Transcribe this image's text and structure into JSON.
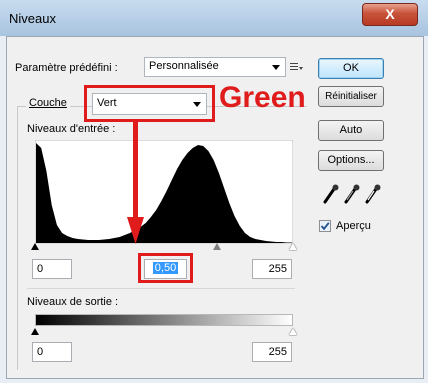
{
  "window": {
    "title": "Niveaux",
    "close_glyph": "X"
  },
  "preset": {
    "label": "Paramètre prédéfini :",
    "value": "Personnalisée",
    "menu_icon": "list-menu-icon"
  },
  "channel": {
    "label": "Couche",
    "value": "Vert"
  },
  "annotation": {
    "text": "Green",
    "color": "#e01b1b"
  },
  "input_levels": {
    "label": "Niveaux d'entrée :",
    "black": "0",
    "gamma": "0,50",
    "white": "255"
  },
  "output_levels": {
    "label": "Niveaux de sortie :",
    "black": "0",
    "white": "255"
  },
  "buttons": {
    "ok": "OK",
    "reset": "Réinitialiser",
    "auto": "Auto",
    "options": "Options..."
  },
  "preview": {
    "label": "Aperçu",
    "checked": true
  },
  "eyedroppers": [
    "black-eyedropper-icon",
    "gray-eyedropper-icon",
    "white-eyedropper-icon"
  ],
  "histogram": {
    "bins": [
      1.0,
      0.95,
      0.72,
      0.38,
      0.18,
      0.1,
      0.07,
      0.05,
      0.04,
      0.035,
      0.03,
      0.03,
      0.03,
      0.035,
      0.04,
      0.05,
      0.06,
      0.08,
      0.1,
      0.13,
      0.16,
      0.2,
      0.26,
      0.33,
      0.42,
      0.52,
      0.63,
      0.74,
      0.83,
      0.9,
      0.95,
      0.98,
      0.97,
      0.92,
      0.83,
      0.7,
      0.55,
      0.4,
      0.27,
      0.17,
      0.1,
      0.06,
      0.04,
      0.03,
      0.02,
      0.015,
      0.01,
      0.01,
      0.005,
      0.005
    ]
  }
}
